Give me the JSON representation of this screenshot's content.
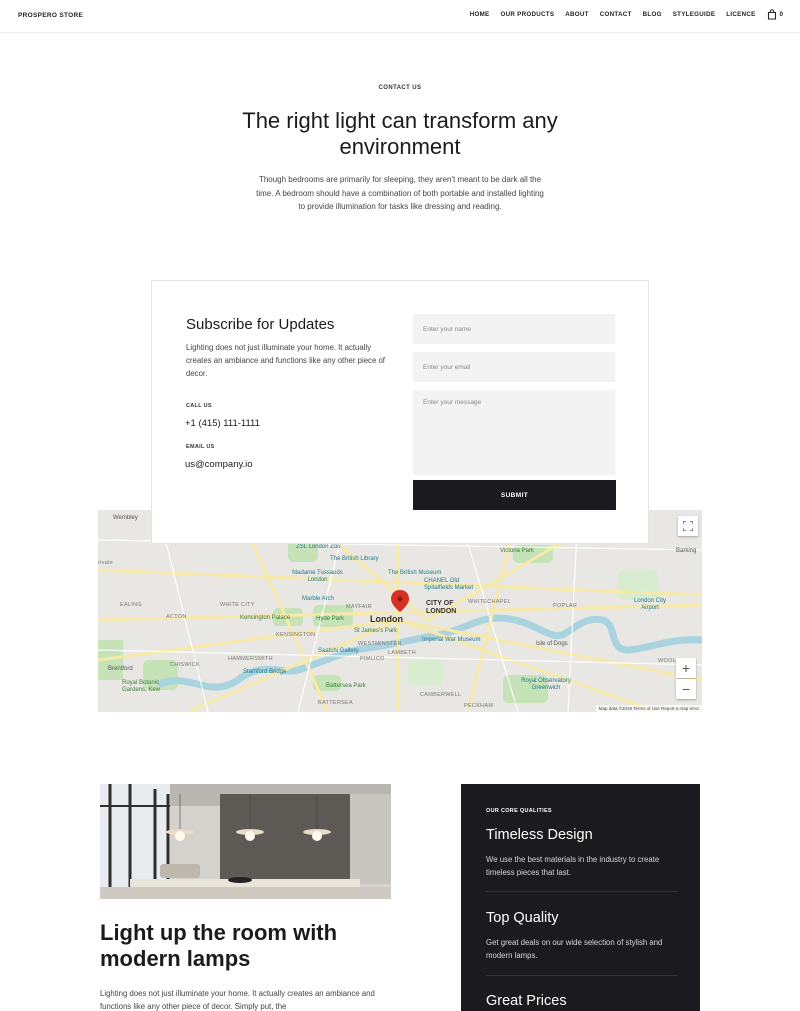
{
  "header": {
    "brand": "PROSPERO STORE",
    "nav": [
      "HOME",
      "OUR PRODUCTS",
      "ABOUT",
      "CONTACT",
      "BLOG",
      "STYLEGUIDE",
      "LICENCE"
    ],
    "cart_count": "0"
  },
  "hero": {
    "eyebrow": "CONTACT US",
    "title": "The right light can transform any environment",
    "body": "Though bedrooms are primarily for sleeping, they aren't meant to be dark all the time. A bedroom should have a combination of both portable and installed lighting to provide illumination for tasks like dressing and reading."
  },
  "subscribe": {
    "title": "Subscribe for Updates",
    "body": "Lighting does not just illuminate your home. It actually creates an ambiance and functions like any other piece of decor.",
    "call_label": "CALL US",
    "phone": "+1 (415) 111-1111",
    "email_label": "EMAIL US",
    "email": "us@company.io",
    "name_placeholder": "Enter your name",
    "email_placeholder": "Enter your email",
    "message_placeholder": "Enter your message",
    "submit_label": "SUBMIT"
  },
  "map": {
    "labels": {
      "wembley": "Wembley",
      "zsl": "ZSL London Zoo",
      "library": "The British Library",
      "victoria_park": "Victoria Park",
      "barking": "Barking",
      "rivale": "rivale",
      "madame": "Madame Tussauds London",
      "museum": "The British Museum",
      "chanel": "CHANEL Old Spitalfields Market",
      "marble": "Marble Arch",
      "mayfair": "MAYFAIR",
      "white_city": "WHITE CITY",
      "ealing": "EALING",
      "city": "CITY OF LONDON",
      "whitechapel": "WHITECHAPEL",
      "poplar": "POPLAR",
      "city_airport": "London City Airport",
      "acton": "ACTON",
      "kensington": "Kensington Palace",
      "hyde_park": "Hyde Park",
      "london": "London",
      "st_james": "St James's Park",
      "kensington_area": "KENSINGTON",
      "westminster": "WESTMINSTER",
      "war_museum": "Imperial War Museum",
      "isle_dogs": "Isle of Dogs",
      "saatchi": "Saatchi Gallery",
      "pimlico": "PIMLICO",
      "lambeth": "LAMBETH",
      "chiswick": "CHISWICK",
      "hammersmith": "HAMMERSMITH",
      "brentford": "Brentford",
      "stamford": "Stamford Bridge",
      "woolwich": "WOOL",
      "kew": "Royal Botanic Gardens, Kew",
      "battersea": "Battersea Park",
      "observatory": "Royal Observatory Greenwich",
      "camberwell": "CAMBERWELL",
      "peckham": "PECKHAM",
      "battersea_area": "BATTERSEA"
    },
    "attribution": "Map data ©2019   Terms of Use   Report a map error",
    "zoom_in": "+",
    "zoom_out": "−"
  },
  "lower": {
    "title": "Light up the room with modern lamps",
    "body": "Lighting does not just illuminate your home. It actually creates an ambiance and functions like any other piece of decor. Simply put, the"
  },
  "qualities": {
    "eyebrow": "OUR CORE QUALITIES",
    "items": [
      {
        "title": "Timeless Design",
        "text": "We use the best materials in the industry to create timeless pieces that last."
      },
      {
        "title": "Top Quality",
        "text": "Get great deals on our wide selection of stylish and modern lamps."
      },
      {
        "title": "Great Prices",
        "text": ""
      }
    ]
  },
  "colors": {
    "dark": "#1b1b1f",
    "field_bg": "#f3f3f3",
    "map_water": "#a9d3df",
    "map_park": "#c5e3b7",
    "map_road": "#f7e9a8",
    "marker": "#d93025"
  }
}
